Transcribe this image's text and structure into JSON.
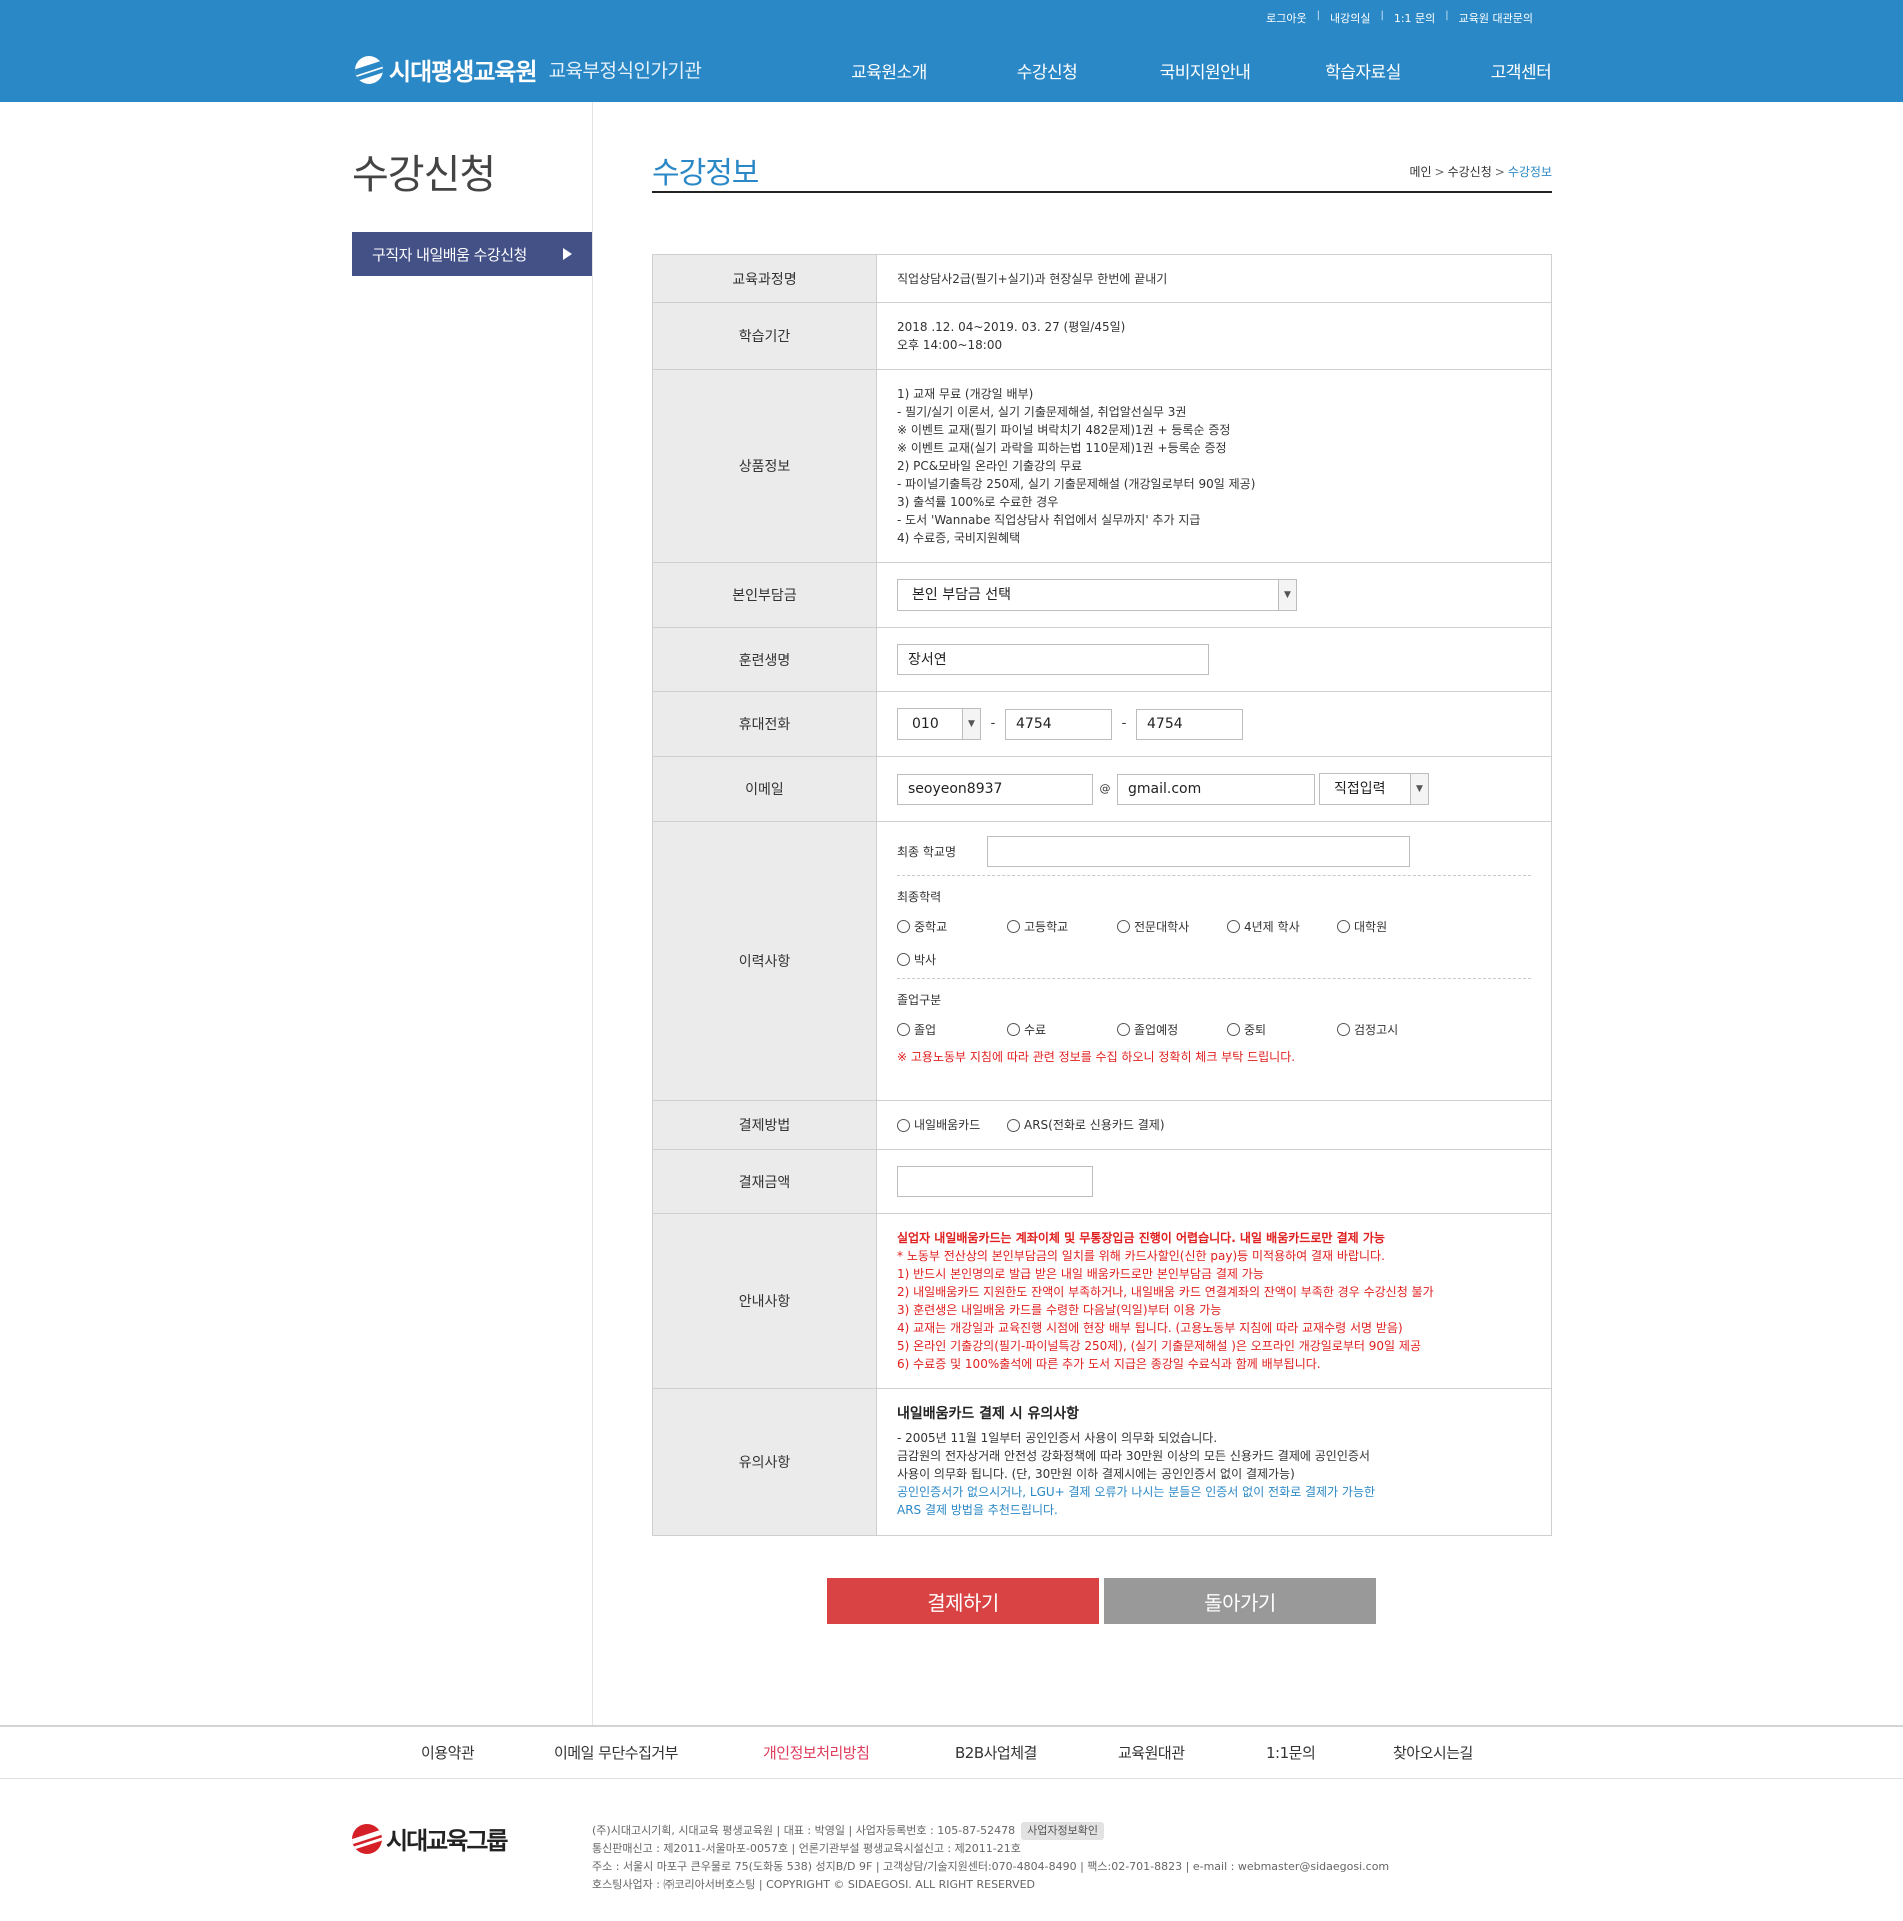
{
  "header": {
    "util_links": [
      "로그아웃",
      "내강의실",
      "1:1 문의",
      "교육원 대관문의"
    ],
    "logo_name": "시대평생교육원",
    "logo_sub": "교육부정식인가기관",
    "nav": [
      "교육원소개",
      "수강신청",
      "국비지원안내",
      "학습자료실",
      "고객센터"
    ]
  },
  "sidebar": {
    "title": "수강신청",
    "menu_button": "구직자 내일배움 수강신청"
  },
  "content": {
    "page_title": "수강정보",
    "breadcrumb": [
      "메인",
      "수강신청",
      "수강정보"
    ]
  },
  "form": {
    "course": {
      "label": "교육과정명",
      "value": "직업상담사2급(필기+실기)과 현장실무 한번에 끝내기"
    },
    "period": {
      "label": "학습기간",
      "lines": [
        "2018 .12. 04~2019. 03. 27 (평일/45일)",
        "오후 14:00~18:00"
      ]
    },
    "product": {
      "label": "상품정보",
      "lines": [
        "1) 교재 무료 (개강일 배부)",
        "- 필기/실기 이론서, 실기 기출문제해설, 취업알선실무 3권",
        "※ 이벤트 교재(필기 파이널 벼락치기 482문제)1권 + 등록순 증정",
        "※ 이벤트 교재(실기 과락을 피하는법 110문제)1권 +등록순 증정",
        "2) PC&모바일 온라인 기출강의 무료",
        "- 파이널기출특강 250제, 실기 기출문제해설 (개강일로부터 90일 제공)",
        "3) 출석률 100%로 수료한 경우",
        "- 도서 'Wannabe 직업상담사 취업에서 실무까지' 추가 지급",
        "4) 수료증, 국비지원혜택"
      ]
    },
    "self_pay": {
      "label": "본인부담금",
      "selected": "본인 부담금 선택"
    },
    "trainee": {
      "label": "훈련생명",
      "value": "장서연"
    },
    "phone": {
      "label": "휴대전화",
      "prefix": "010",
      "middle": "4754",
      "last": "4754"
    },
    "email": {
      "label": "이메일",
      "id": "seoyeon8937",
      "at": "@",
      "domain": "gmail.com",
      "domain_select": "직접입력"
    },
    "history": {
      "label": "이력사항",
      "school_label": "최종 학교명",
      "school_value": "",
      "edu_label": "최종학력",
      "edu_options": [
        "중학교",
        "고등학교",
        "전문대학사",
        "4년제 학사",
        "대학원",
        "박사"
      ],
      "grad_label": "졸업구분",
      "grad_options": [
        "졸업",
        "수료",
        "졸업예정",
        "중퇴",
        "검정고시"
      ],
      "note": "※ 고용노동부 지침에 따라 관련 정보를 수집 하오니 정확히 체크 부탁 드립니다."
    },
    "payment_method": {
      "label": "결제방법",
      "options": [
        "내일배움카드",
        "ARS(전화로 신용카드 결제)"
      ]
    },
    "amount": {
      "label": "결재금액",
      "value": ""
    },
    "guide": {
      "label": "안내사항",
      "headline": "실업자 내일배움카드는 계좌이체 및 무통장입금 진행이 어렵습니다. 내일 배움카드로만 결제 가능",
      "lines": [
        "* 노동부 전산상의 본인부담금의 일치를 위해 카드사할인(신한 pay)등 미적용하여 결재 바랍니다.",
        "1) 반드시 본인명의로 발급 받은 내일 배움카드로만 본인부담금 결제 가능",
        "2) 내일배움카드 지원한도 잔액이 부족하거나, 내일배움 카드 연결계좌의 잔액이 부족한 경우 수강신청 불가",
        "3) 훈련생은 내일배움 카드를 수령한 다음날(익일)부터 이용 가능",
        "4) 교재는 개강일과 교육진행 시점에 현장 배부 됩니다. (고용노동부 지침에 따라 교재수령 서명 받음)",
        "5) 온라인 기출강의(필기-파이널특강 250제), (실기 기출문제해설 )은 오프라인 개강일로부터 90일 제공",
        "6) 수료증 및 100%출석에 따른 추가 도서 지급은 종강일 수료식과 함께 배부됩니다."
      ]
    },
    "caution": {
      "label": "유의사항",
      "title": "내일배움카드 결제 시 유의사항",
      "lines": [
        "- 2005년 11월 1일부터 공인인증서 사용이 의무화 되었습니다.",
        "금감원의 전자상거래 안전성 강화정책에 따라 30만원 이상의 모든 신용카드 결제에 공인인증서",
        "사용이 의무화 됩니다. (단, 30만원 이하 결제시에는 공인인증서 없이 결제가능)"
      ],
      "blue_lines": [
        "공인인증서가 없으시거나, LGU+ 결제 오류가 나시는 분들은 인증서 없이 전화로 결제가 가능한",
        "ARS 결제 방법을 추천드립니다."
      ]
    }
  },
  "buttons": {
    "pay": "결제하기",
    "back": "돌아가기"
  },
  "footer": {
    "links": [
      "이용약관",
      "이메일 무단수집거부",
      "개인정보처리방침",
      "B2B사업체결",
      "교육원대관",
      "1:1문의",
      "찾아오시는길"
    ],
    "logo": "시대교육그룹",
    "info": [
      "(주)시대고시기획, 시대교육 평생교육원 | 대표 : 박영일 | 사업자등록번호 : 105-87-52478",
      "통신판매신고 : 제2011-서울마포-0057호 | 언론기관부설 평생교육시설신고 : 제2011-21호",
      "주소 : 서울시 마포구 큰우물로 75(도화동 538) 성지B/D 9F | 고객상담/기술지원센터:070-4804-8490 | 팩스:02-701-8823 | e-mail : webmaster@sidaegosi.com",
      "호스팅사업자 : ㈜코리아서버호스팅 | COPYRIGHT © SIDAEGOSI. ALL RIGHT RESERVED"
    ],
    "badge": "사업자정보확인"
  },
  "colors": {
    "header_blue": "#2a88c6",
    "nav_button": "#435187",
    "pay_red": "#d94343",
    "back_gray": "#999999"
  }
}
